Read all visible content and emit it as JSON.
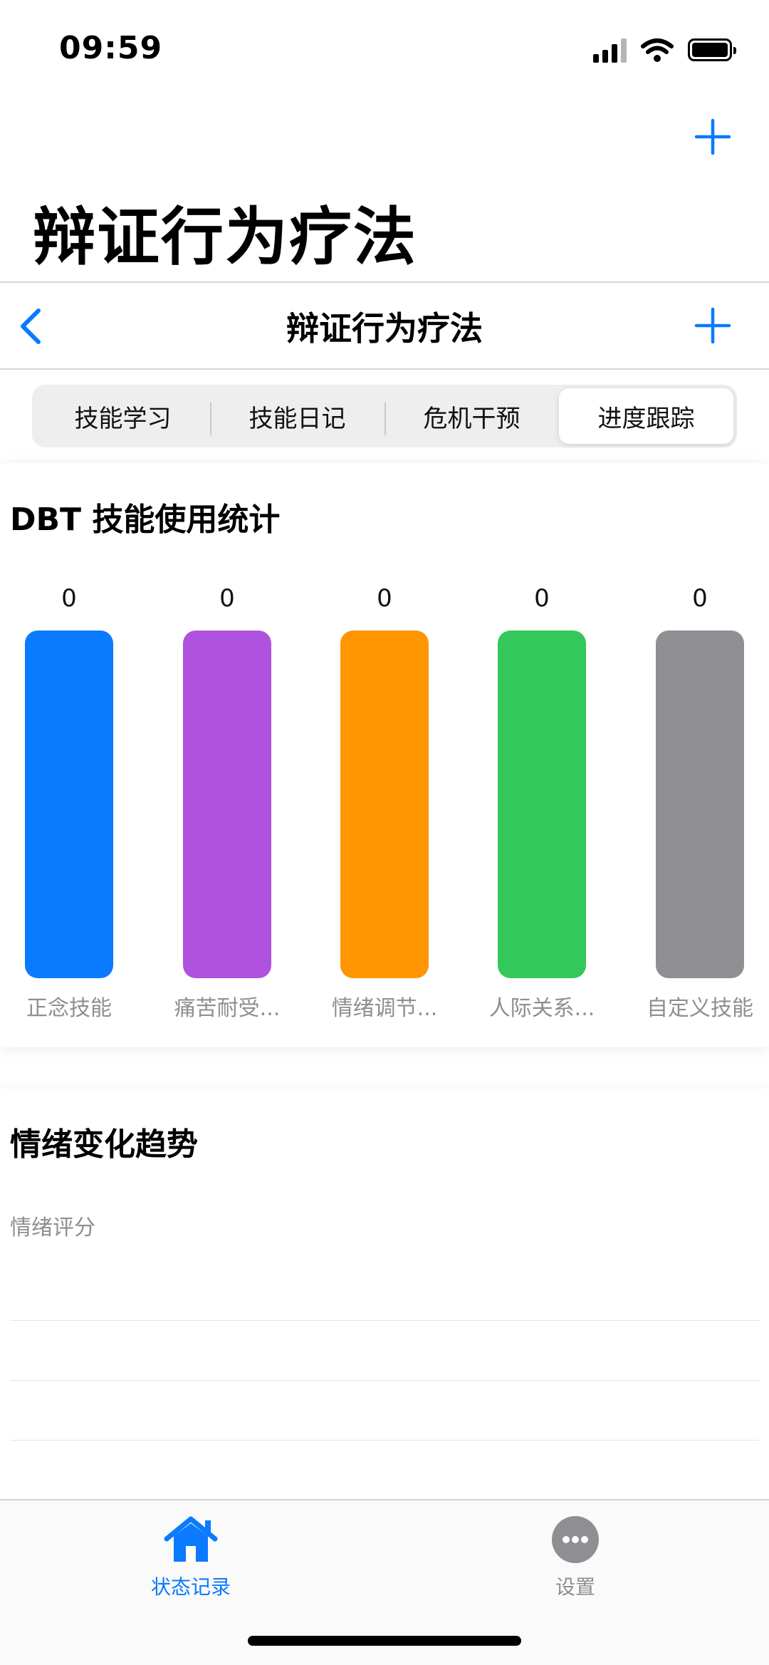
{
  "status_bar": {
    "time": "09:59"
  },
  "header": {
    "large_title": "辩证行为疗法"
  },
  "nav": {
    "title": "辩证行为疗法"
  },
  "segments": [
    {
      "label": "技能学习",
      "active": false
    },
    {
      "label": "技能日记",
      "active": false
    },
    {
      "label": "危机干预",
      "active": false
    },
    {
      "label": "进度跟踪",
      "active": true
    }
  ],
  "skills_card": {
    "title": "DBT 技能使用统计"
  },
  "chart_data": {
    "type": "bar",
    "categories": [
      "正念技能",
      "痛苦耐受...",
      "情绪调节...",
      "人际关系...",
      "自定义技能"
    ],
    "values": [
      0,
      0,
      0,
      0,
      0
    ],
    "data_labels": [
      "0",
      "0",
      "0",
      "0",
      "0"
    ],
    "colors": [
      "#0A7AFF",
      "#AF52DE",
      "#FF9500",
      "#34C759",
      "#8E8E93"
    ],
    "title": "DBT 技能使用统计"
  },
  "mood_card": {
    "title": "情绪变化趋势",
    "axis_label": "情绪评分"
  },
  "tab_bar": {
    "tabs": [
      {
        "label": "状态记录",
        "icon": "house-icon",
        "active": true
      },
      {
        "label": "设置",
        "icon": "more-icon",
        "active": false
      }
    ]
  },
  "colors": {
    "accent": "#0A7AFF",
    "inactive": "#8E8E93"
  }
}
